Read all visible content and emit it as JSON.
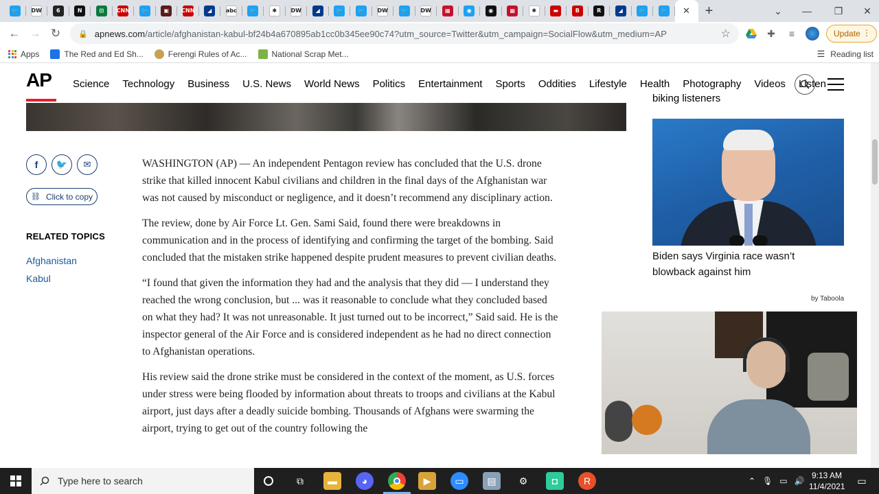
{
  "browser": {
    "tabs": [
      {
        "icon": "twitter-icon",
        "color": "#1da1f2",
        "glyph": "🐦"
      },
      {
        "icon": "dw-icon",
        "color": "#ffffff",
        "glyph": "DW"
      },
      {
        "icon": "news-icon",
        "color": "#222222",
        "glyph": "6"
      },
      {
        "icon": "news-icon",
        "color": "#111111",
        "glyph": "N"
      },
      {
        "icon": "news-icon",
        "color": "#0a7a3a",
        "glyph": "⊡"
      },
      {
        "icon": "cnn-icon",
        "color": "#cc0000",
        "glyph": "CNN"
      },
      {
        "icon": "twitter-icon",
        "color": "#1da1f2",
        "glyph": "🐦"
      },
      {
        "icon": "news-icon",
        "color": "#5a1a1a",
        "glyph": "▣"
      },
      {
        "icon": "cnn-icon",
        "color": "#cc0000",
        "glyph": "CNN"
      },
      {
        "icon": "news-icon",
        "color": "#003a8c",
        "glyph": "◢"
      },
      {
        "icon": "abc-icon",
        "color": "#ffffff",
        "glyph": "abc"
      },
      {
        "icon": "twitter-icon",
        "color": "#1da1f2",
        "glyph": "🐦"
      },
      {
        "icon": "nbc-icon",
        "color": "#ffffff",
        "glyph": "✱"
      },
      {
        "icon": "dw-icon",
        "color": "#ffffff",
        "glyph": "DW"
      },
      {
        "icon": "news-icon",
        "color": "#003a8c",
        "glyph": "◢"
      },
      {
        "icon": "twitter-icon",
        "color": "#1da1f2",
        "glyph": "🐦"
      },
      {
        "icon": "twitter-icon",
        "color": "#1da1f2",
        "glyph": "🐦"
      },
      {
        "icon": "dw-icon",
        "color": "#ffffff",
        "glyph": "DW"
      },
      {
        "icon": "twitter-icon",
        "color": "#1da1f2",
        "glyph": "🐦"
      },
      {
        "icon": "dw-icon",
        "color": "#ffffff",
        "glyph": "DW"
      },
      {
        "icon": "news-icon",
        "color": "#c8102e",
        "glyph": "▦"
      },
      {
        "icon": "news-icon",
        "color": "#1da1f2",
        "glyph": "◉"
      },
      {
        "icon": "cbs-icon",
        "color": "#111111",
        "glyph": "◉"
      },
      {
        "icon": "news-icon",
        "color": "#c8102e",
        "glyph": "▦"
      },
      {
        "icon": "nbc-icon",
        "color": "#ffffff",
        "glyph": "✱"
      },
      {
        "icon": "news-icon",
        "color": "#cc0000",
        "glyph": "▬"
      },
      {
        "icon": "news-icon",
        "color": "#cc0000",
        "glyph": "B"
      },
      {
        "icon": "news-icon",
        "color": "#111111",
        "glyph": "R"
      },
      {
        "icon": "news-icon",
        "color": "#003a8c",
        "glyph": "◢"
      },
      {
        "icon": "twitter-icon",
        "color": "#1da1f2",
        "glyph": "🐦"
      },
      {
        "icon": "twitter-icon",
        "color": "#1da1f2",
        "glyph": "🐦"
      }
    ],
    "url_host": "apnews.com",
    "url_rest": "/article/afghanistan-kabul-bf24b4a670895ab1cc0b345ee90c74?utm_source=Twitter&utm_campaign=SocialFlow&utm_medium=AP",
    "update_label": "Update",
    "bookmarks": [
      {
        "label": "Apps",
        "icon": "apps-icon"
      },
      {
        "label": "The Red and Ed Sh...",
        "icon": "bookmark-page-icon"
      },
      {
        "label": "Ferengi Rules of Ac...",
        "icon": "bookmark-page-icon"
      },
      {
        "label": "National Scrap Met...",
        "icon": "bookmark-page-icon"
      }
    ],
    "reading_list": "Reading list"
  },
  "site": {
    "logo": "AP",
    "nav": [
      "Science",
      "Technology",
      "Business",
      "U.S. News",
      "World News",
      "Politics",
      "Entertainment",
      "Sports",
      "Oddities",
      "Lifestyle",
      "Health",
      "Photography",
      "Videos",
      "Listen"
    ],
    "copy_label": "Click to copy",
    "related_title": "RELATED TOPICS",
    "related_topics": [
      "Afghanistan",
      "Kabul"
    ]
  },
  "article": {
    "paragraphs": [
      "WASHINGTON (AP) — An independent Pentagon review has concluded that the U.S. drone strike that killed innocent Kabul civilians and children in the final days of the Afghanistan war was not caused by misconduct or negligence, and it doesn’t recommend any disciplinary action.",
      "The review, done by Air Force Lt. Gen. Sami Said, found there were breakdowns in communication and in the process of identifying and confirming the target of the bombing. Said concluded that the mistaken strike happened despite prudent measures to prevent civilian deaths.",
      "“I found that given the information they had and the analysis that they did — I understand they reached the wrong conclusion, but ... was it reasonable to conclude what they concluded based on what they had? It was not unreasonable. It just turned out to be incorrect,” Said said. He is the inspector general of the Air Force and is considered independent as he had no direct connection to Afghanistan operations.",
      "His review said the drone strike must be considered in the context of the moment, as U.S. forces under stress were being flooded by information about threats to troops and civilians at the Kabul airport, just days after a deadly suicide bombing. Thousands of Afghans were swarming the airport, trying to get out of the country following the"
    ]
  },
  "sidebar": {
    "cutoff_text": "biking listeners",
    "headline": "Biden says Virginia race wasn’t blowback against him",
    "sponsor": "by Taboola"
  },
  "taskbar": {
    "search_placeholder": "Type here to search",
    "time": "9:13 AM",
    "date": "11/4/2021"
  }
}
